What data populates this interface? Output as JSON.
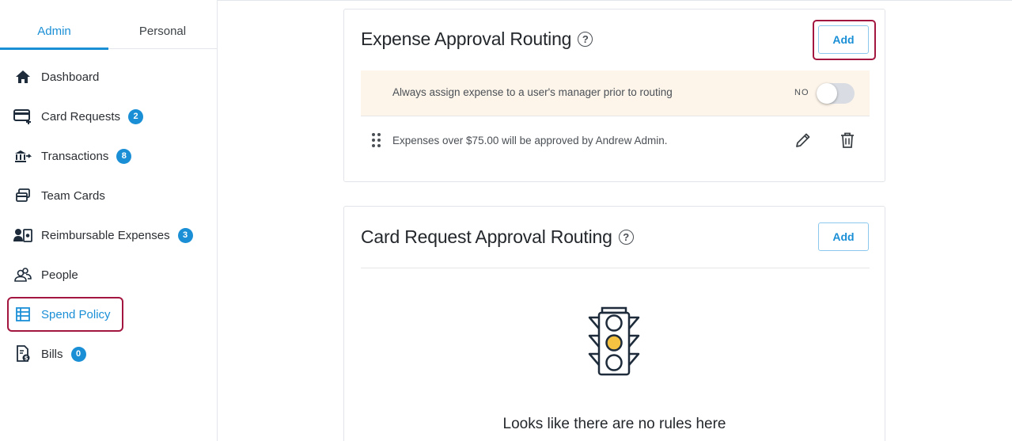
{
  "sidebar": {
    "tabs": [
      {
        "label": "Admin",
        "active": true
      },
      {
        "label": "Personal",
        "active": false
      }
    ],
    "items": [
      {
        "label": "Dashboard",
        "icon": "home-icon",
        "badge": null
      },
      {
        "label": "Card Requests",
        "icon": "card-add-icon",
        "badge": "2"
      },
      {
        "label": "Transactions",
        "icon": "transactions-icon",
        "badge": "8"
      },
      {
        "label": "Team Cards",
        "icon": "team-cards-icon",
        "badge": null
      },
      {
        "label": "Reimbursable Expenses",
        "icon": "reimbursable-icon",
        "badge": "3"
      },
      {
        "label": "People",
        "icon": "people-icon",
        "badge": null
      },
      {
        "label": "Spend Policy",
        "icon": "spend-policy-icon",
        "badge": null,
        "active": true
      },
      {
        "label": "Bills",
        "icon": "bills-icon",
        "badge": "0"
      }
    ]
  },
  "expense_routing": {
    "title": "Expense Approval Routing",
    "help": "?",
    "add_label": "Add",
    "manager_setting": {
      "text": "Always assign expense to a user's manager prior to routing",
      "toggle_label": "NO",
      "enabled": false
    },
    "rules": [
      {
        "text": "Expenses over $75.00 will be approved by Andrew Admin."
      }
    ]
  },
  "card_request_routing": {
    "title": "Card Request Approval Routing",
    "help": "?",
    "add_label": "Add",
    "empty_text": "Looks like there are no rules here"
  },
  "colors": {
    "accent": "#1a8fd6",
    "highlight": "#a3163f",
    "setting_bg": "#fdf5ea",
    "traffic_light_yellow": "#f5c242"
  }
}
